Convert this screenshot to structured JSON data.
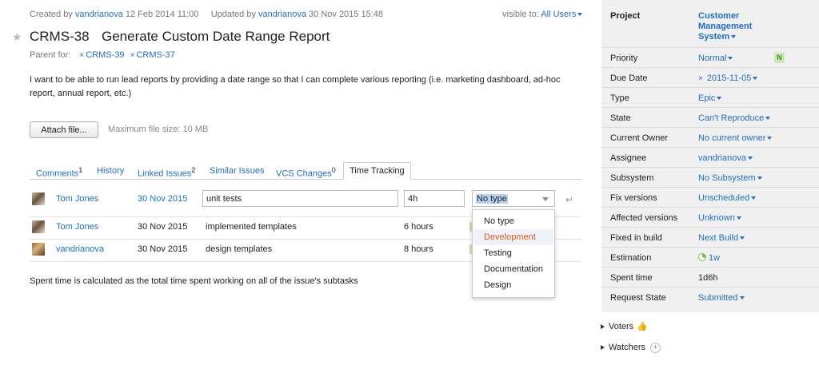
{
  "meta": {
    "created_prefix": "Created by",
    "created_user": "vandrianova",
    "created_date": "12 Feb 2014 11:00",
    "updated_prefix": "Updated by",
    "updated_user": "vandrianova",
    "updated_date": "30 Nov 2015 15:48",
    "visible_prefix": "visible to:",
    "visible_value": "All Users"
  },
  "issue": {
    "id": "CRMS-38",
    "title": "Generate Custom Date Range Report",
    "parent_label": "Parent for:",
    "parents": [
      "CRMS-39",
      "CRMS-37"
    ],
    "description": "I want to be able to run lead reports by providing a date range so that I can complete various reporting (i.e. marketing dashboard, ad-hoc report, annual report, etc.)"
  },
  "attach": {
    "button_label": "Attach file...",
    "max_size": "Maximum file size: 10 MB"
  },
  "tabs": [
    {
      "label": "Comments",
      "count": "1"
    },
    {
      "label": "History",
      "count": ""
    },
    {
      "label": "Linked Issues",
      "count": "2"
    },
    {
      "label": "Similar Issues",
      "count": ""
    },
    {
      "label": "VCS Changes",
      "count": "0"
    },
    {
      "label": "Time Tracking",
      "count": ""
    }
  ],
  "edit_row": {
    "user": "Tom Jones",
    "date": "30 Nov 2015",
    "description_value": "unit tests",
    "time_value": "4h",
    "type_value": "No type"
  },
  "type_options": [
    "No type",
    "Development",
    "Testing",
    "Documentation",
    "Design"
  ],
  "work_items": [
    {
      "user": "Tom Jones",
      "date": "30 Nov 2015",
      "description": "implemented templates",
      "time": "6 hours"
    },
    {
      "user": "vandrianova",
      "date": "30 Nov 2015",
      "description": "design templates",
      "time": "8 hours"
    }
  ],
  "footnote": "Spent time is calculated as the total time spent working on all of the issue's subtasks",
  "fields": [
    {
      "label": "Project",
      "value": "Customer Management System"
    },
    {
      "label": "Priority",
      "value": "Normal",
      "badge": "N"
    },
    {
      "label": "Due Date",
      "value": "2015-11-05"
    },
    {
      "label": "Type",
      "value": "Epic"
    },
    {
      "label": "State",
      "value": "Can't Reproduce"
    },
    {
      "label": "Current Owner",
      "value": "No current owner"
    },
    {
      "label": "Assignee",
      "value": "vandrianova"
    },
    {
      "label": "Subsystem",
      "value": "No Subsystem"
    },
    {
      "label": "Fix versions",
      "value": "Unscheduled"
    },
    {
      "label": "Affected versions",
      "value": "Unknown"
    },
    {
      "label": "Fixed in build",
      "value": "Next Build"
    },
    {
      "label": "Estimation",
      "value": "1w"
    },
    {
      "label": "Spent time",
      "value": "1d6h"
    },
    {
      "label": "Request State",
      "value": "Submitted"
    }
  ],
  "sidebar_sections": {
    "voters": "Voters",
    "watchers": "Watchers"
  },
  "colors": {
    "link": "#1f6fc5",
    "highlight_option": "#e3581c",
    "panel_bg": "#f0f0f0"
  }
}
